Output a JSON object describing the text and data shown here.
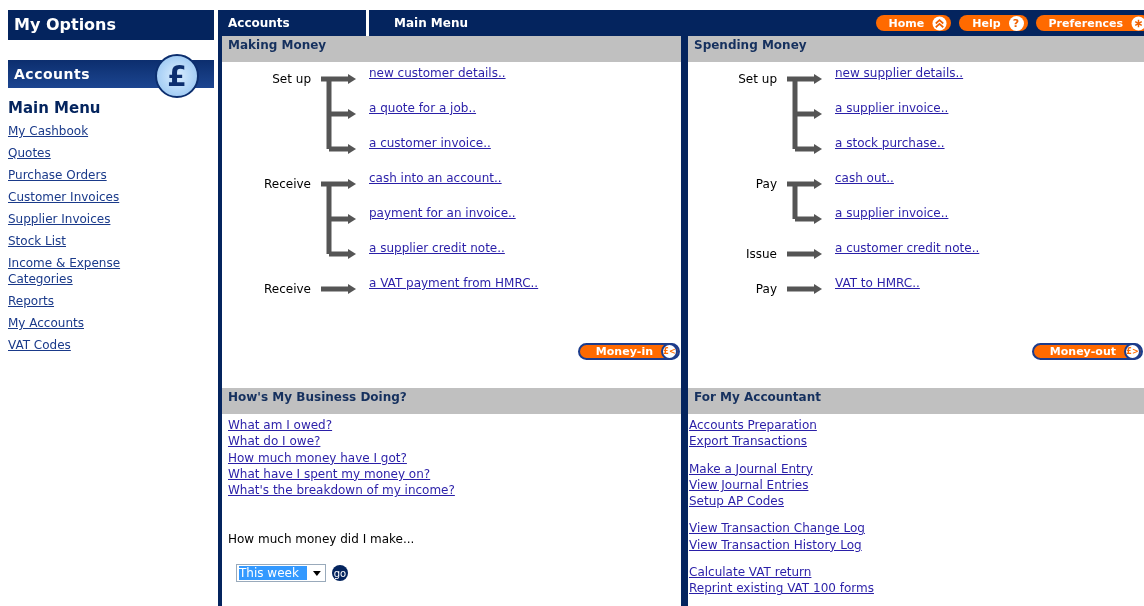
{
  "sidebar": {
    "title": "My Options",
    "section": {
      "title": "Accounts",
      "icon_text": "£"
    },
    "menu_title": "Main Menu",
    "items": [
      "My Cashbook",
      "Quotes",
      "Purchase Orders",
      "Customer Invoices",
      "Supplier Invoices",
      "Stock List",
      "Income & Expense Categories",
      "Reports",
      "My Accounts",
      "VAT Codes"
    ]
  },
  "top_bar": {
    "tab": "Accounts",
    "title": "Main Menu",
    "buttons": [
      {
        "label": "Home",
        "kind": "home"
      },
      {
        "label": "Help",
        "kind": "help",
        "icon_text": "?"
      },
      {
        "label": "Preferences",
        "kind": "preferences"
      }
    ]
  },
  "making_money": {
    "title": "Making Money",
    "groups": [
      {
        "label": "Set up",
        "links": [
          "new customer details..",
          "a quote for a job..",
          "a customer invoice.."
        ]
      },
      {
        "label": "Receive",
        "links": [
          "cash into an account..",
          "payment for an invoice..",
          "a supplier credit note.."
        ]
      },
      {
        "label": "Receive",
        "links": [
          "a VAT payment from HMRC.."
        ]
      }
    ],
    "button": {
      "label": "Money-in",
      "icon_text": "£<"
    }
  },
  "spending_money": {
    "title": "Spending Money",
    "groups": [
      {
        "label": "Set up",
        "links": [
          "new supplier details..",
          "a supplier invoice..",
          "a stock purchase.."
        ]
      },
      {
        "label": "Pay",
        "links": [
          "cash out..",
          "a supplier invoice.."
        ]
      },
      {
        "label": "Issue",
        "links": [
          "a customer credit note.."
        ]
      },
      {
        "label": "Pay",
        "links": [
          "VAT to HMRC.."
        ]
      }
    ],
    "button": {
      "label": "Money-out",
      "icon_text": "£>"
    }
  },
  "business": {
    "title": "How's My Business Doing?",
    "links": [
      "What am I owed?",
      "What do I owe?",
      "How much money have I got?",
      "What have I spent my money on?",
      "What's the breakdown of my income?"
    ],
    "prompt": "How much money did I make...",
    "period": {
      "value": "This week"
    },
    "go": "go"
  },
  "accountant": {
    "title": "For My Accountant",
    "link_groups": [
      [
        "Accounts Preparation",
        "Export Transactions"
      ],
      [
        "Make a Journal Entry",
        "View Journal Entries",
        "Setup AP Codes"
      ],
      [
        "View Transaction Change Log",
        "View Transaction History Log"
      ],
      [
        "Calculate VAT return",
        "Reprint existing VAT 100 forms"
      ]
    ]
  }
}
